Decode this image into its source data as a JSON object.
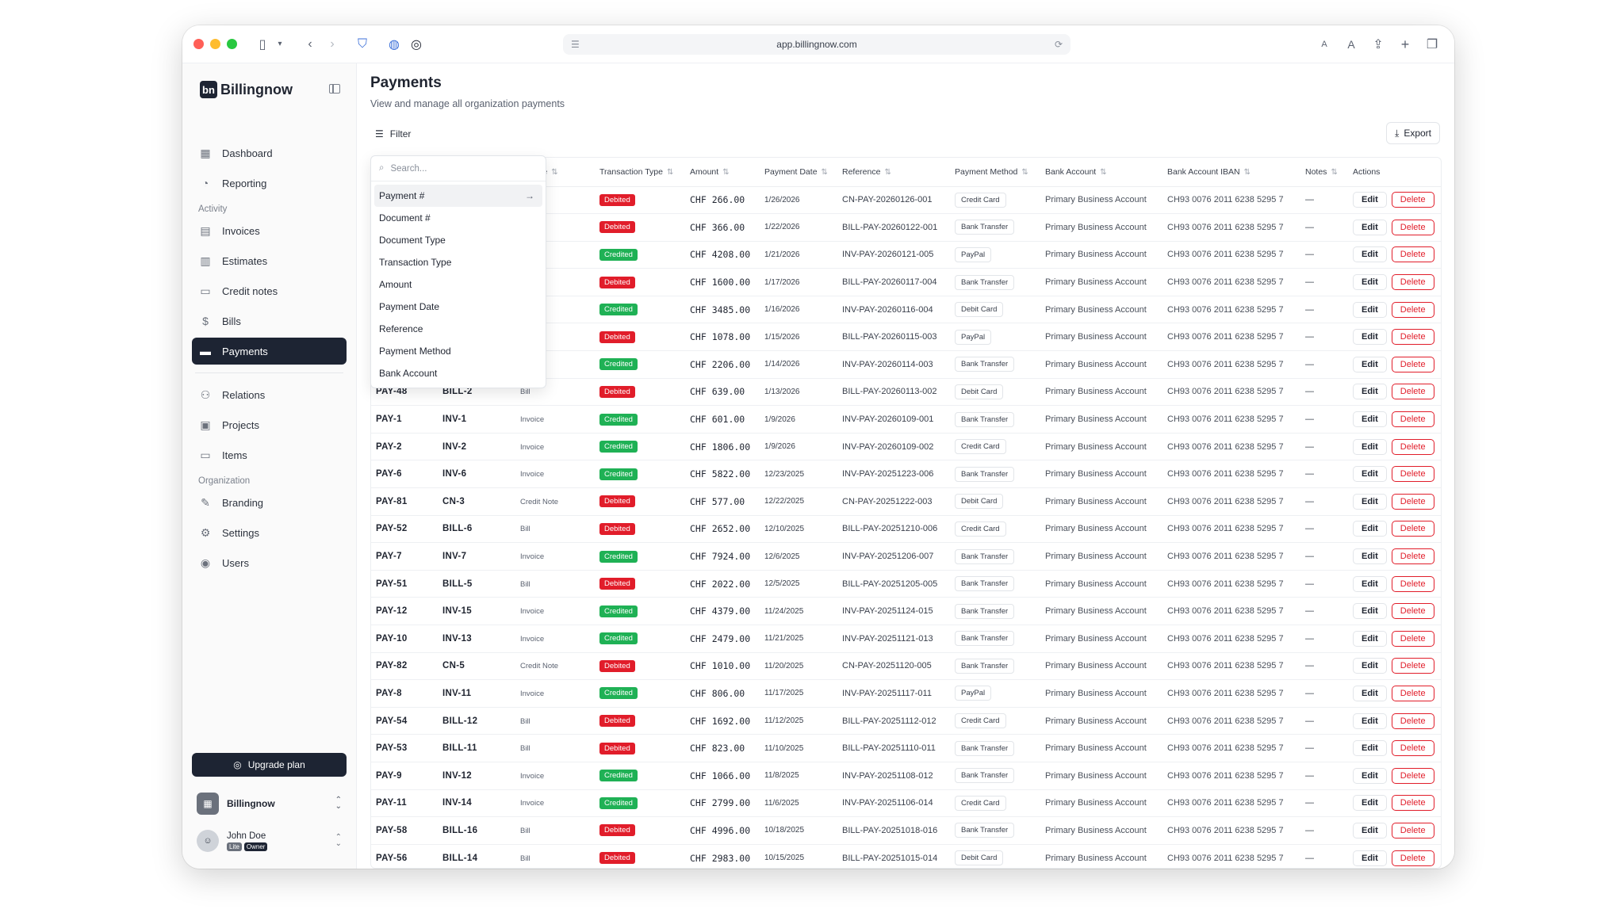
{
  "browser": {
    "url": "app.billingnow.com",
    "colors": {
      "close": "#ff5f57",
      "min": "#febc2e",
      "max": "#28c840"
    }
  },
  "sidebar": {
    "logo_mark": "bn",
    "logo_text": "Billingnow",
    "items_top": [
      {
        "label": "Dashboard",
        "icon": "dashboard-icon",
        "glyph": "▦"
      },
      {
        "label": "Reporting",
        "icon": "pie-chart-icon",
        "glyph": "◔"
      }
    ],
    "section_activity": "Activity",
    "items_activity": [
      {
        "label": "Invoices",
        "icon": "document-icon",
        "glyph": "▤"
      },
      {
        "label": "Estimates",
        "icon": "calculator-icon",
        "glyph": "▥"
      },
      {
        "label": "Credit notes",
        "icon": "receipt-icon",
        "glyph": "▭"
      },
      {
        "label": "Bills",
        "icon": "bill-icon",
        "glyph": "$"
      },
      {
        "label": "Payments",
        "icon": "credit-card-icon",
        "glyph": "▬",
        "active": true
      }
    ],
    "items_mid": [
      {
        "label": "Relations",
        "icon": "users-icon",
        "glyph": "⚇"
      },
      {
        "label": "Projects",
        "icon": "project-icon",
        "glyph": "▣"
      },
      {
        "label": "Items",
        "icon": "inbox-icon",
        "glyph": "▭"
      }
    ],
    "section_org": "Organization",
    "items_org": [
      {
        "label": "Branding",
        "icon": "brush-icon",
        "glyph": "✎"
      },
      {
        "label": "Settings",
        "icon": "gear-icon",
        "glyph": "⚙"
      },
      {
        "label": "Users",
        "icon": "user-circle-icon",
        "glyph": "◉"
      }
    ],
    "upgrade_label": "Upgrade plan",
    "org_name": "Billingnow",
    "user_name": "John Doe",
    "user_badges": [
      "Lite",
      "Owner"
    ]
  },
  "main": {
    "title": "Payments",
    "subtitle": "View and manage all organization payments",
    "filter_label": "Filter",
    "export_label": "Export",
    "columns": [
      "Payment #",
      "Document #",
      "Document Type",
      "Transaction Type",
      "Amount",
      "Payment Date",
      "Reference",
      "Payment Method",
      "Bank Account",
      "Bank Account IBAN",
      "Notes",
      "Actions"
    ],
    "column_header_partial": "nt Type",
    "edit_label": "Edit",
    "delete_label": "Delete",
    "dropdown": {
      "search_placeholder": "Search...",
      "items": [
        "Payment #",
        "Document #",
        "Document Type",
        "Transaction Type",
        "Amount",
        "Payment Date",
        "Reference",
        "Payment Method",
        "Bank Account"
      ]
    },
    "rows": [
      {
        "pay": "",
        "doc": "",
        "type": "Note",
        "tx": "Debited",
        "amount": "CHF 266.00",
        "date": "1/26/2026",
        "ref": "CN-PAY-20260126-001",
        "method": "Credit Card",
        "bank": "Primary Business Account",
        "iban": "CH93 0076 2011 6238 5295 7",
        "notes": "—"
      },
      {
        "pay": "",
        "doc": "",
        "type": "",
        "tx": "Debited",
        "amount": "CHF 366.00",
        "date": "1/22/2026",
        "ref": "BILL-PAY-20260122-001",
        "method": "Bank Transfer",
        "bank": "Primary Business Account",
        "iban": "CH93 0076 2011 6238 5295 7",
        "notes": "—"
      },
      {
        "pay": "",
        "doc": "",
        "type": "",
        "tx": "Credited",
        "amount": "CHF 4208.00",
        "date": "1/21/2026",
        "ref": "INV-PAY-20260121-005",
        "method": "PayPal",
        "bank": "Primary Business Account",
        "iban": "CH93 0076 2011 6238 5295 7",
        "notes": "—"
      },
      {
        "pay": "",
        "doc": "",
        "type": "",
        "tx": "Debited",
        "amount": "CHF 1600.00",
        "date": "1/17/2026",
        "ref": "BILL-PAY-20260117-004",
        "method": "Bank Transfer",
        "bank": "Primary Business Account",
        "iban": "CH93 0076 2011 6238 5295 7",
        "notes": "—"
      },
      {
        "pay": "",
        "doc": "",
        "type": "",
        "tx": "Credited",
        "amount": "CHF 3485.00",
        "date": "1/16/2026",
        "ref": "INV-PAY-20260116-004",
        "method": "Debit Card",
        "bank": "Primary Business Account",
        "iban": "CH93 0076 2011 6238 5295 7",
        "notes": "—"
      },
      {
        "pay": "",
        "doc": "",
        "type": "",
        "tx": "Debited",
        "amount": "CHF 1078.00",
        "date": "1/15/2026",
        "ref": "BILL-PAY-20260115-003",
        "method": "PayPal",
        "bank": "Primary Business Account",
        "iban": "CH93 0076 2011 6238 5295 7",
        "notes": "—"
      },
      {
        "pay": "",
        "doc": "",
        "type": "",
        "tx": "Credited",
        "amount": "CHF 2206.00",
        "date": "1/14/2026",
        "ref": "INV-PAY-20260114-003",
        "method": "Bank Transfer",
        "bank": "Primary Business Account",
        "iban": "CH93 0076 2011 6238 5295 7",
        "notes": "—"
      },
      {
        "pay": "PAY-48",
        "doc": "BILL-2",
        "type": "Bill",
        "tx": "Debited",
        "amount": "CHF 639.00",
        "date": "1/13/2026",
        "ref": "BILL-PAY-20260113-002",
        "method": "Debit Card",
        "bank": "Primary Business Account",
        "iban": "CH93 0076 2011 6238 5295 7",
        "notes": "—"
      },
      {
        "pay": "PAY-1",
        "doc": "INV-1",
        "type": "Invoice",
        "tx": "Credited",
        "amount": "CHF 601.00",
        "date": "1/9/2026",
        "ref": "INV-PAY-20260109-001",
        "method": "Bank Transfer",
        "bank": "Primary Business Account",
        "iban": "CH93 0076 2011 6238 5295 7",
        "notes": "—"
      },
      {
        "pay": "PAY-2",
        "doc": "INV-2",
        "type": "Invoice",
        "tx": "Credited",
        "amount": "CHF 1806.00",
        "date": "1/9/2026",
        "ref": "INV-PAY-20260109-002",
        "method": "Credit Card",
        "bank": "Primary Business Account",
        "iban": "CH93 0076 2011 6238 5295 7",
        "notes": "—"
      },
      {
        "pay": "PAY-6",
        "doc": "INV-6",
        "type": "Invoice",
        "tx": "Credited",
        "amount": "CHF 5822.00",
        "date": "12/23/2025",
        "ref": "INV-PAY-20251223-006",
        "method": "Bank Transfer",
        "bank": "Primary Business Account",
        "iban": "CH93 0076 2011 6238 5295 7",
        "notes": "—"
      },
      {
        "pay": "PAY-81",
        "doc": "CN-3",
        "type": "Credit Note",
        "tx": "Debited",
        "amount": "CHF 577.00",
        "date": "12/22/2025",
        "ref": "CN-PAY-20251222-003",
        "method": "Debit Card",
        "bank": "Primary Business Account",
        "iban": "CH93 0076 2011 6238 5295 7",
        "notes": "—"
      },
      {
        "pay": "PAY-52",
        "doc": "BILL-6",
        "type": "Bill",
        "tx": "Debited",
        "amount": "CHF 2652.00",
        "date": "12/10/2025",
        "ref": "BILL-PAY-20251210-006",
        "method": "Credit Card",
        "bank": "Primary Business Account",
        "iban": "CH93 0076 2011 6238 5295 7",
        "notes": "—"
      },
      {
        "pay": "PAY-7",
        "doc": "INV-7",
        "type": "Invoice",
        "tx": "Credited",
        "amount": "CHF 7924.00",
        "date": "12/6/2025",
        "ref": "INV-PAY-20251206-007",
        "method": "Bank Transfer",
        "bank": "Primary Business Account",
        "iban": "CH93 0076 2011 6238 5295 7",
        "notes": "—"
      },
      {
        "pay": "PAY-51",
        "doc": "BILL-5",
        "type": "Bill",
        "tx": "Debited",
        "amount": "CHF 2022.00",
        "date": "12/5/2025",
        "ref": "BILL-PAY-20251205-005",
        "method": "Bank Transfer",
        "bank": "Primary Business Account",
        "iban": "CH93 0076 2011 6238 5295 7",
        "notes": "—"
      },
      {
        "pay": "PAY-12",
        "doc": "INV-15",
        "type": "Invoice",
        "tx": "Credited",
        "amount": "CHF 4379.00",
        "date": "11/24/2025",
        "ref": "INV-PAY-20251124-015",
        "method": "Bank Transfer",
        "bank": "Primary Business Account",
        "iban": "CH93 0076 2011 6238 5295 7",
        "notes": "—"
      },
      {
        "pay": "PAY-10",
        "doc": "INV-13",
        "type": "Invoice",
        "tx": "Credited",
        "amount": "CHF 2479.00",
        "date": "11/21/2025",
        "ref": "INV-PAY-20251121-013",
        "method": "Bank Transfer",
        "bank": "Primary Business Account",
        "iban": "CH93 0076 2011 6238 5295 7",
        "notes": "—"
      },
      {
        "pay": "PAY-82",
        "doc": "CN-5",
        "type": "Credit Note",
        "tx": "Debited",
        "amount": "CHF 1010.00",
        "date": "11/20/2025",
        "ref": "CN-PAY-20251120-005",
        "method": "Bank Transfer",
        "bank": "Primary Business Account",
        "iban": "CH93 0076 2011 6238 5295 7",
        "notes": "—"
      },
      {
        "pay": "PAY-8",
        "doc": "INV-11",
        "type": "Invoice",
        "tx": "Credited",
        "amount": "CHF 806.00",
        "date": "11/17/2025",
        "ref": "INV-PAY-20251117-011",
        "method": "PayPal",
        "bank": "Primary Business Account",
        "iban": "CH93 0076 2011 6238 5295 7",
        "notes": "—"
      },
      {
        "pay": "PAY-54",
        "doc": "BILL-12",
        "type": "Bill",
        "tx": "Debited",
        "amount": "CHF 1692.00",
        "date": "11/12/2025",
        "ref": "BILL-PAY-20251112-012",
        "method": "Credit Card",
        "bank": "Primary Business Account",
        "iban": "CH93 0076 2011 6238 5295 7",
        "notes": "—"
      },
      {
        "pay": "PAY-53",
        "doc": "BILL-11",
        "type": "Bill",
        "tx": "Debited",
        "amount": "CHF 823.00",
        "date": "11/10/2025",
        "ref": "BILL-PAY-20251110-011",
        "method": "Bank Transfer",
        "bank": "Primary Business Account",
        "iban": "CH93 0076 2011 6238 5295 7",
        "notes": "—"
      },
      {
        "pay": "PAY-9",
        "doc": "INV-12",
        "type": "Invoice",
        "tx": "Credited",
        "amount": "CHF 1066.00",
        "date": "11/8/2025",
        "ref": "INV-PAY-20251108-012",
        "method": "Bank Transfer",
        "bank": "Primary Business Account",
        "iban": "CH93 0076 2011 6238 5295 7",
        "notes": "—"
      },
      {
        "pay": "PAY-11",
        "doc": "INV-14",
        "type": "Invoice",
        "tx": "Credited",
        "amount": "CHF 2799.00",
        "date": "11/6/2025",
        "ref": "INV-PAY-20251106-014",
        "method": "Credit Card",
        "bank": "Primary Business Account",
        "iban": "CH93 0076 2011 6238 5295 7",
        "notes": "—"
      },
      {
        "pay": "PAY-58",
        "doc": "BILL-16",
        "type": "Bill",
        "tx": "Debited",
        "amount": "CHF 4996.00",
        "date": "10/18/2025",
        "ref": "BILL-PAY-20251018-016",
        "method": "Bank Transfer",
        "bank": "Primary Business Account",
        "iban": "CH93 0076 2011 6238 5295 7",
        "notes": "—"
      },
      {
        "pay": "PAY-56",
        "doc": "BILL-14",
        "type": "Bill",
        "tx": "Debited",
        "amount": "CHF 2983.00",
        "date": "10/15/2025",
        "ref": "BILL-PAY-20251015-014",
        "method": "Debit Card",
        "bank": "Primary Business Account",
        "iban": "CH93 0076 2011 6238 5295 7",
        "notes": "—"
      }
    ]
  }
}
